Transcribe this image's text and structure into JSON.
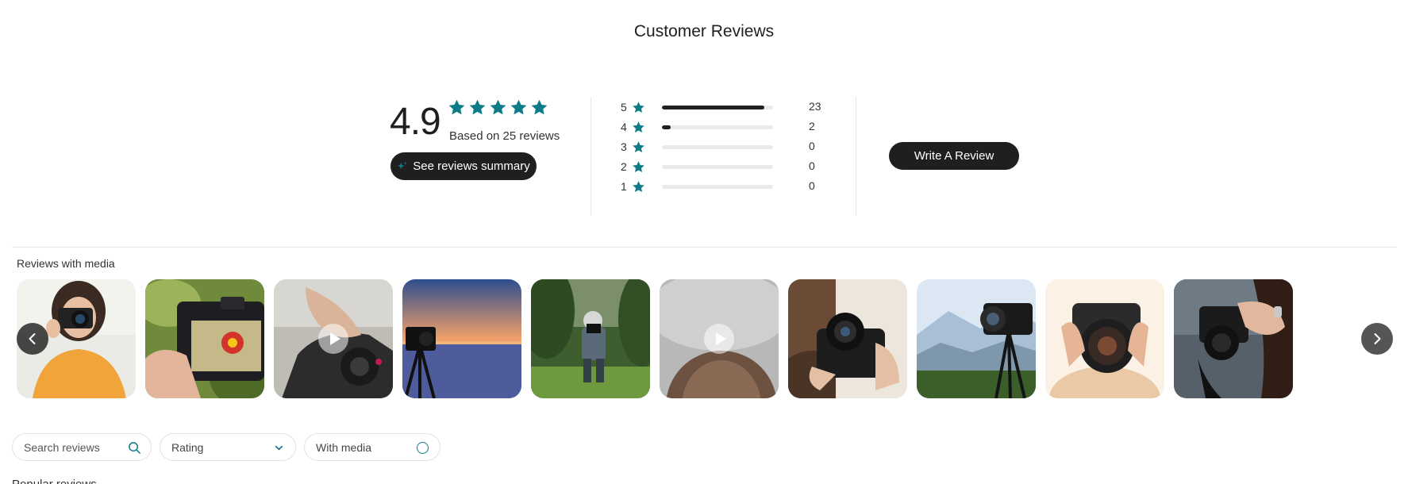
{
  "header": {
    "title": "Customer Reviews"
  },
  "summary": {
    "average": "4.9",
    "stars_filled": 5,
    "based_on": "Based on 25 reviews",
    "summary_button": "See reviews summary"
  },
  "distribution": [
    {
      "stars": "5",
      "count": "23",
      "fraction": 0.92
    },
    {
      "stars": "4",
      "count": "2",
      "fraction": 0.08
    },
    {
      "stars": "3",
      "count": "0",
      "fraction": 0
    },
    {
      "stars": "2",
      "count": "0",
      "fraction": 0
    },
    {
      "stars": "1",
      "count": "0",
      "fraction": 0
    }
  ],
  "write_review": {
    "label": "Write A Review"
  },
  "media": {
    "label": "Reviews with media",
    "thumbnails": [
      {
        "icon": "photo-woman-camera-icon",
        "is_video": false
      },
      {
        "icon": "photo-camera-flower-icon",
        "is_video": false
      },
      {
        "icon": "video-hand-camera-icon",
        "is_video": true
      },
      {
        "icon": "photo-sunset-tripod-icon",
        "is_video": false
      },
      {
        "icon": "photo-child-camera-icon",
        "is_video": false
      },
      {
        "icon": "video-hair-icon",
        "is_video": true
      },
      {
        "icon": "photo-hands-dslr-icon",
        "is_video": false
      },
      {
        "icon": "photo-mountain-tripod-icon",
        "is_video": false
      },
      {
        "icon": "photo-lens-closeup-icon",
        "is_video": false
      },
      {
        "icon": "photo-woman-holding-camera-icon",
        "is_video": false
      }
    ]
  },
  "filters": {
    "search_placeholder": "Search reviews",
    "rating_label": "Rating",
    "media_toggle_label": "With media"
  },
  "sort": {
    "label": "Popular reviews"
  },
  "colors": {
    "accent": "#0e7c88",
    "dark": "#1f1f1f",
    "track": "#eaeaea"
  }
}
